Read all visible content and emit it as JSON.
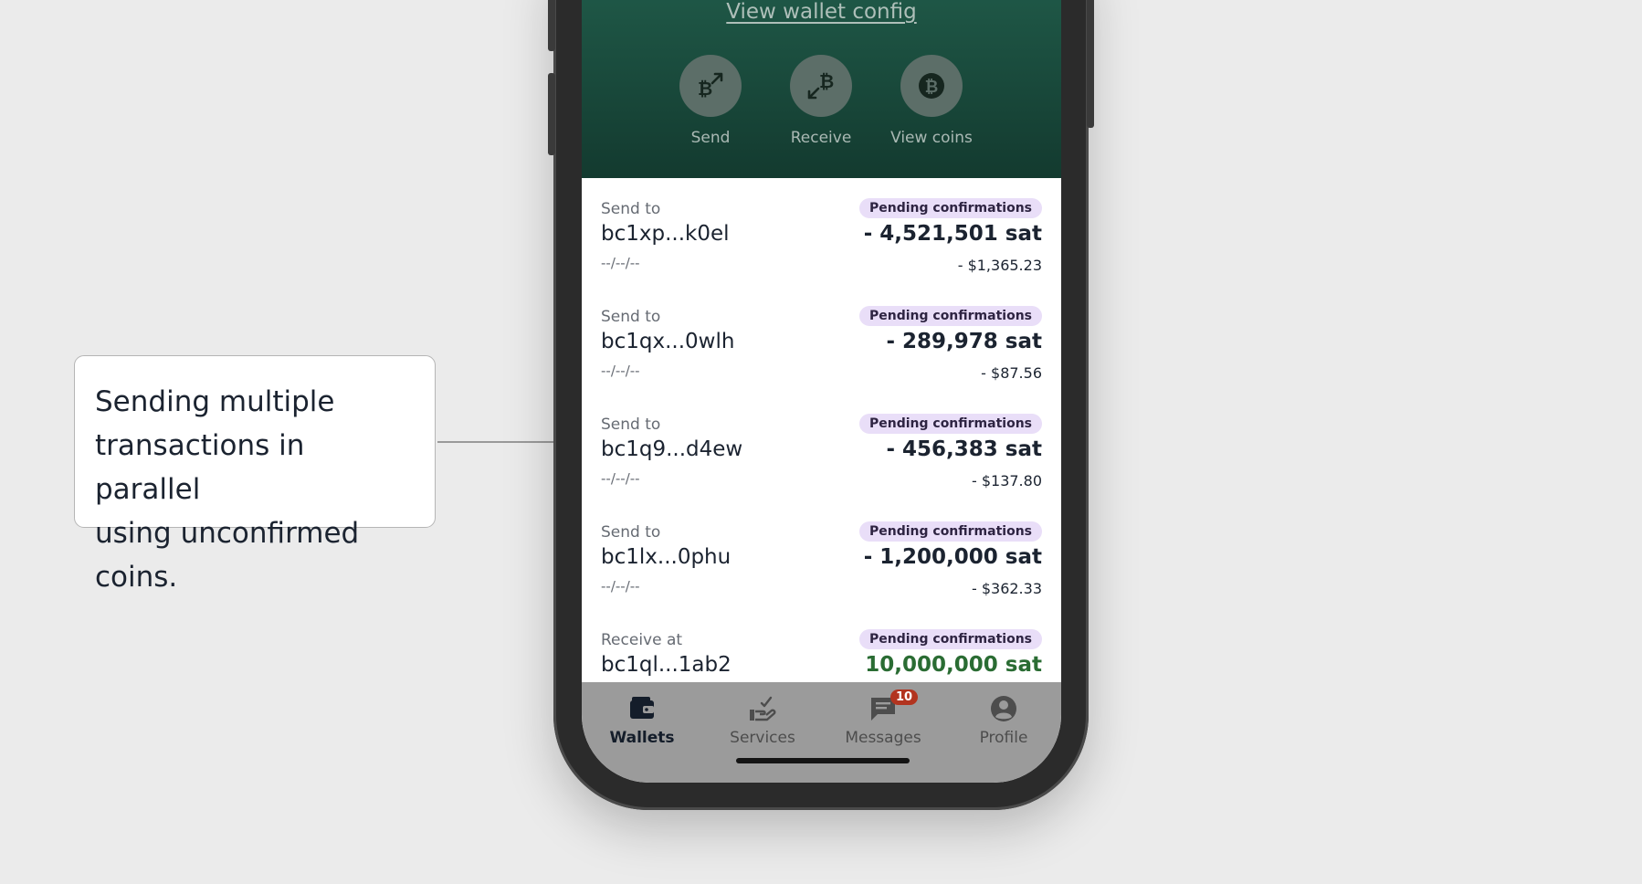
{
  "callout": {
    "lines": [
      "Sending multiple",
      "transactions in parallel",
      "using unconfirmed coins."
    ]
  },
  "header": {
    "wallet_config_link": "View wallet config",
    "actions": [
      {
        "label": "Send",
        "icon": "bitcoin-send-icon"
      },
      {
        "label": "Receive",
        "icon": "bitcoin-receive-icon"
      },
      {
        "label": "View coins",
        "icon": "bitcoin-coin-icon"
      }
    ]
  },
  "transactions": [
    {
      "type": "Send to",
      "address": "bc1xp...k0el",
      "date": "--/--/--",
      "status": "Pending confirmations",
      "amount": "- 4,521,501 sat",
      "fiat": "- $1,365.23"
    },
    {
      "type": "Send to",
      "address": "bc1qx...0wlh",
      "date": "--/--/--",
      "status": "Pending confirmations",
      "amount": "- 289,978 sat",
      "fiat": "- $87.56"
    },
    {
      "type": "Send to",
      "address": "bc1q9...d4ew",
      "date": "--/--/--",
      "status": "Pending confirmations",
      "amount": "- 456,383 sat",
      "fiat": "- $137.80"
    },
    {
      "type": "Send to",
      "address": "bc1lx...0phu",
      "date": "--/--/--",
      "status": "Pending confirmations",
      "amount": "- 1,200,000 sat",
      "fiat": "- $362.33"
    },
    {
      "type": "Receive at",
      "address": "bc1ql...1ab2",
      "date": "",
      "status": "Pending confirmations",
      "amount": "10,000,000 sat",
      "fiat": ""
    }
  ],
  "tabbar": {
    "tabs": [
      {
        "label": "Wallets",
        "icon": "wallet-icon",
        "active": true
      },
      {
        "label": "Services",
        "icon": "services-hand-icon",
        "active": false
      },
      {
        "label": "Messages",
        "icon": "messages-icon",
        "active": false,
        "badge": "10"
      },
      {
        "label": "Profile",
        "icon": "profile-icon",
        "active": false
      }
    ]
  },
  "colors": {
    "header_top": "#1f5847",
    "header_bottom": "#133a2f",
    "badge_bg": "#e9def8",
    "positive_amount": "#2a6c33",
    "notification": "#b2341f"
  }
}
